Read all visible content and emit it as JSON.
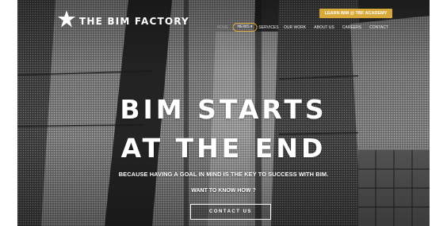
{
  "brand": {
    "name": "THE BIM FACTORY",
    "logo_icon": "star-icon"
  },
  "header": {
    "academy_button": "LEARN BIM @ TBF ACADEMY",
    "accent_color": "#d8a93a",
    "nav": [
      {
        "label": "HOME",
        "key": "home"
      },
      {
        "label": "NEWS ▾",
        "key": "news"
      },
      {
        "label": "SERVICES",
        "key": "services"
      },
      {
        "label": "OUR WORK",
        "key": "our-work"
      },
      {
        "label": "ABOUT US",
        "key": "about-us"
      },
      {
        "label": "CAREERS",
        "key": "careers"
      },
      {
        "label": "CONTACT",
        "key": "contact"
      }
    ]
  },
  "hero": {
    "headline_line1": "BIM STARTS",
    "headline_line2": "AT THE END",
    "subtitle": "BECAUSE HAVING A GOAL IN MIND IS THE KEY TO SUCCESS WITH BIM.",
    "question": "WANT TO KNOW HOW ?",
    "cta_button": "CONTACT US"
  }
}
